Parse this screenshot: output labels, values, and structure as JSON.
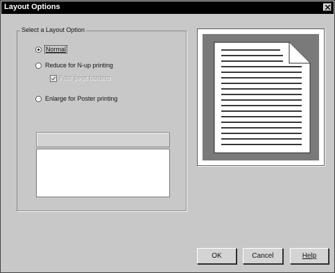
{
  "window": {
    "title": "Layout Options"
  },
  "layout_group": {
    "legend": "Select a Layout Option",
    "options": [
      {
        "label": "Normal",
        "checked": true
      },
      {
        "label": "Reduce for N-up printing",
        "checked": false
      },
      {
        "label": "Enlarge for Poster printing",
        "checked": false
      }
    ],
    "print_page_borders": {
      "label": "Print page borders",
      "checked": true,
      "enabled": false
    }
  },
  "buttons": {
    "ok": "OK",
    "cancel": "Cancel",
    "help": "Help"
  }
}
